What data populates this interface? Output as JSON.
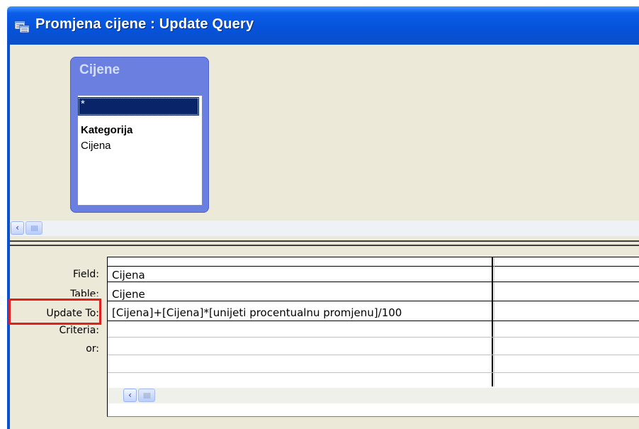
{
  "window": {
    "title": "Promjena cijene : Update Query"
  },
  "field_list": {
    "table_name": "Cijene",
    "items": [
      {
        "label": "*",
        "selected": true,
        "bold": false
      },
      {
        "label": "Kategorija",
        "selected": false,
        "bold": true
      },
      {
        "label": "Cijena",
        "selected": false,
        "bold": false
      }
    ]
  },
  "design_grid": {
    "row_labels": {
      "field": "Field:",
      "table": "Table:",
      "update_to": "Update To:",
      "criteria": "Criteria:",
      "or": "or:"
    },
    "column_1": {
      "field": "Cijena",
      "table": "Cijene",
      "update_to": "[Cijena]+[Cijena]*[unijeti procentualnu promjenu]/100",
      "criteria": "",
      "or": ""
    }
  },
  "colors": {
    "titlebar": "#0652d9",
    "field_list_header": "#6a7fe0",
    "selection": "#0a246a",
    "highlight_box": "#e0201c"
  },
  "icons": [
    "query-icon",
    "scroll-left-icon",
    "scroll-thumb-grip-icon"
  ]
}
